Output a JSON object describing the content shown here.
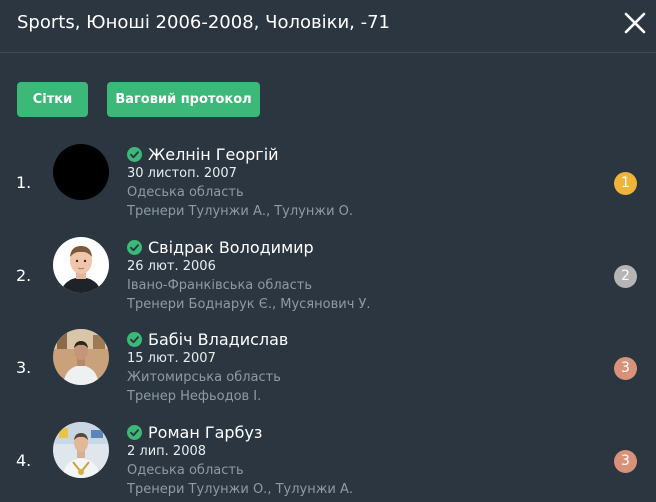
{
  "header": {
    "title": "Sports, Юноші 2006-2008, Чоловіки, -71",
    "close_icon": "close-icon"
  },
  "actions": {
    "grids_label": "Сітки",
    "weigh_label": "Ваговий протокол",
    "accent_color": "#3cb878"
  },
  "athletes": [
    {
      "rank": "1.",
      "name": "Желнін Георгій",
      "dob": "30 листоп. 2007",
      "region": "Одеська область",
      "coaches": "Тренери Тулунжи А.,  Тулунжи О.",
      "place": "1",
      "place_color": "#f0b43a"
    },
    {
      "rank": "2.",
      "name": "Свідрак Володимир",
      "dob": "26 лют. 2006",
      "region": "Івано-Франківська область",
      "coaches": "Тренери Боднарук Є.,  Мусянович У.",
      "place": "2",
      "place_color": "#b5b5b5"
    },
    {
      "rank": "3.",
      "name": "Бабіч Владислав",
      "dob": "15 лют. 2007",
      "region": "Житомирська область",
      "coaches": "Тренер Нефьодов І.",
      "place": "3",
      "place_color": "#d9927a"
    },
    {
      "rank": "4.",
      "name": "Роман Гарбуз",
      "dob": "2 лип. 2008",
      "region": "Одеська область",
      "coaches": "Тренери Тулунжи О.,  Тулунжи А.",
      "place": "3",
      "place_color": "#d9927a"
    }
  ]
}
